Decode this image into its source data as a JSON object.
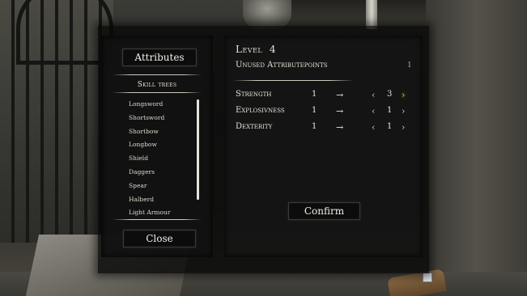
{
  "menu": {
    "attributes_button": "Attributes",
    "skill_trees_title": "Skill trees",
    "skills": [
      "Longsword",
      "Shortsword",
      "Shortbow",
      "Longbow",
      "Shield",
      "Daggers",
      "Spear",
      "Halberd",
      "Light Armour"
    ],
    "close_button": "Close",
    "level_label": "Level",
    "level_value": "4",
    "unused_label": "Unused Attributepoints",
    "unused_value": "1",
    "attributes": [
      {
        "name": "Strength",
        "current": "1",
        "arrow": "→",
        "dec": "‹",
        "new": "3",
        "inc": "›"
      },
      {
        "name": "Explosivness",
        "current": "1",
        "arrow": "→",
        "dec": "‹",
        "new": "1",
        "inc": "›"
      },
      {
        "name": "Dexterity",
        "current": "1",
        "arrow": "→",
        "dec": "‹",
        "new": "1",
        "inc": "›"
      }
    ],
    "confirm_button": "Confirm"
  },
  "colors": {
    "unused_value": "#8fa6d8",
    "highlight_arrow": "#e9c75a"
  },
  "icons": [
    "increase-arrow-icon",
    "decrease-arrow-icon",
    "right-arrow-icon"
  ]
}
